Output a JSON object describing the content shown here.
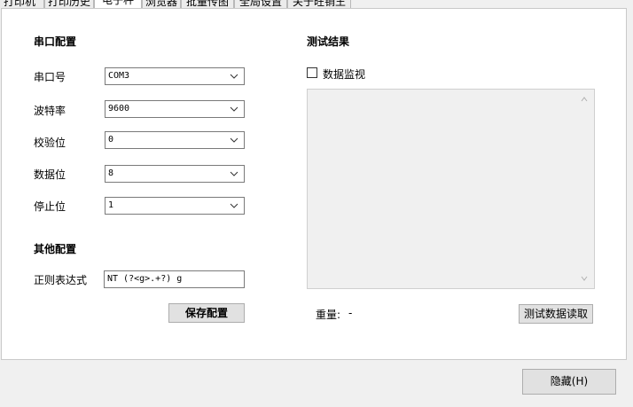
{
  "tabs": [
    {
      "label": "打印机",
      "active": false
    },
    {
      "label": "打印历史",
      "active": false
    },
    {
      "label": "电子秤",
      "active": true
    },
    {
      "label": "浏览器",
      "active": false
    },
    {
      "label": "批量传图",
      "active": false
    },
    {
      "label": "全局设置",
      "active": false
    },
    {
      "label": "关于旺销王",
      "active": false
    }
  ],
  "serial_config": {
    "title": "串口配置",
    "fields": [
      {
        "label": "串口号",
        "value": "COM3"
      },
      {
        "label": "波特率",
        "value": "9600"
      },
      {
        "label": "校验位",
        "value": "0"
      },
      {
        "label": "数据位",
        "value": "8"
      },
      {
        "label": "停止位",
        "value": "1"
      }
    ]
  },
  "other_config": {
    "title": "其他配置",
    "regex_label": "正则表达式",
    "regex_value": "NT (?<g>.+?) g",
    "save_button": "保存配置"
  },
  "test_result": {
    "title": "测试结果",
    "monitor_label": "数据监视",
    "monitor_checked": false,
    "weight_label": "重量:",
    "weight_value": "-",
    "read_button": "测试数据读取"
  },
  "footer": {
    "hide_button": "隐藏(H)"
  }
}
